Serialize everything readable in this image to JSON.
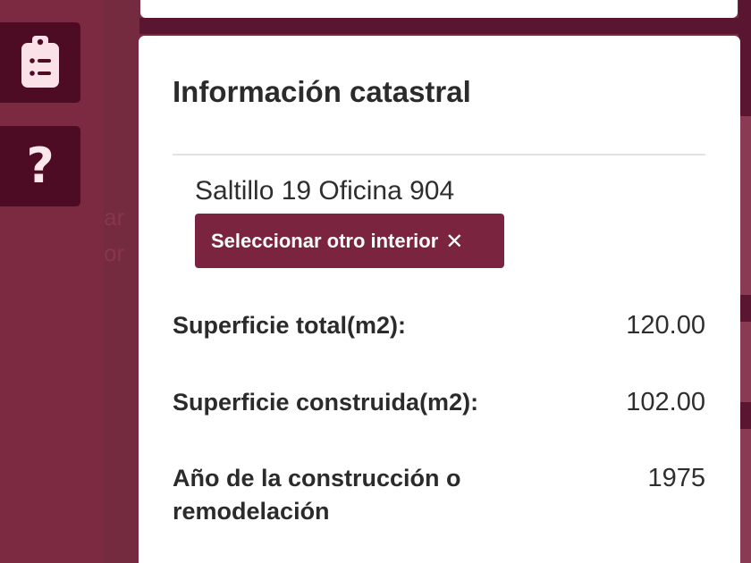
{
  "sidebar": {
    "items": [
      {
        "icon": "clipboard-list-icon"
      },
      {
        "icon": "help-icon",
        "glyph": "?"
      }
    ]
  },
  "panel": {
    "title": "Información catastral",
    "address": "Saltillo 19 Oficina 904",
    "select_button_label": "Seleccionar otro interior",
    "close_glyph": "✕",
    "details": [
      {
        "label": "Superficie total(m2):",
        "value": "120.00"
      },
      {
        "label": "Superficie construida(m2):",
        "value": "102.00"
      },
      {
        "label": "Año de la construcción o remodelación",
        "value": "1975"
      }
    ]
  },
  "colors": {
    "brand": "#7b2440",
    "sidebar_button": "#4d0c24",
    "background": "#7a2a40"
  }
}
